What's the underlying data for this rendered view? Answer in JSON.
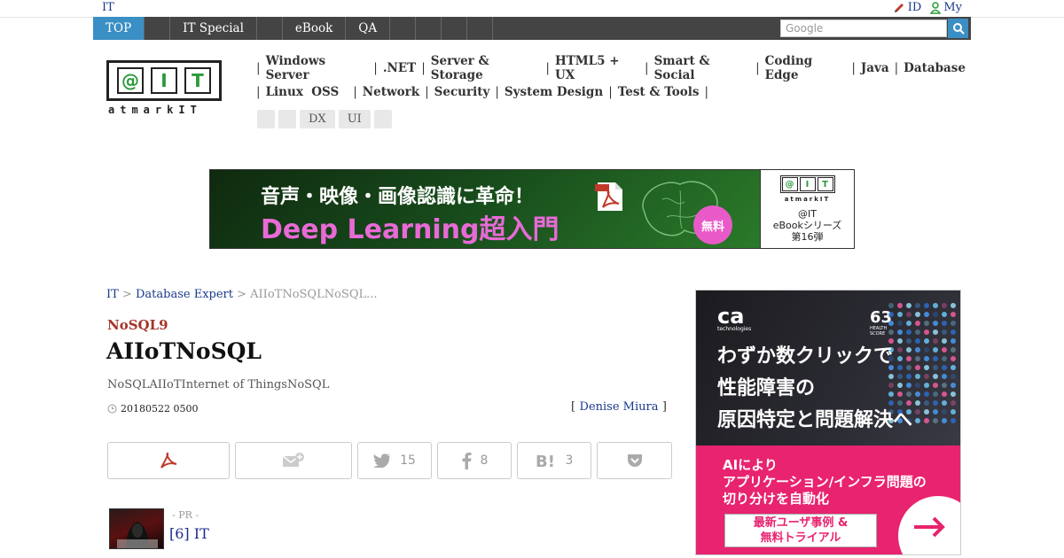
{
  "top_strip": {
    "site_label": "IT",
    "id_link": "ID",
    "my_link": "My"
  },
  "nav": {
    "items": [
      "TOP",
      "",
      "IT Special",
      "",
      "eBook",
      "QA",
      "",
      "",
      "",
      ""
    ],
    "search_placeholder": "Google"
  },
  "logo": {
    "cells": [
      "@",
      "I",
      "T"
    ],
    "subtitle": "atmarkIT"
  },
  "categories": {
    "row1": [
      "Windows Server",
      ".NET",
      "Server & Storage",
      "HTML5 + UX",
      "Smart & Social",
      "Coding Edge",
      "Java",
      "Database"
    ],
    "row2": [
      "Linux  OSS",
      "Network",
      "Security",
      "System Design",
      "Test & Tools"
    ],
    "tags": [
      "",
      "",
      "DX",
      "UI",
      ""
    ]
  },
  "banner": {
    "line1": "音声・映像・画像認識に革命！",
    "line2": "Deep Learning超入門",
    "free_badge": "無料",
    "side_logo": [
      "@",
      "I",
      "T"
    ],
    "side_logo_sub": "atmarkIT",
    "side_line1": "@IT",
    "side_line2": "eBookシリーズ",
    "side_line3": "第16弾"
  },
  "breadcrumb": {
    "home": "IT",
    "sep": " > ",
    "section": "Database Expert",
    "current": "AIIoTNoSQLNoSQL..."
  },
  "article": {
    "series": "NoSQL9",
    "title": "AIIoTNoSQL",
    "subtitle": "NoSQLAIIoTInternet of ThingsNoSQL",
    "date": "20180522 0500",
    "author_open": "[",
    "author": "Denise Miura",
    "author_close": "]"
  },
  "share": {
    "twitter_count": "15",
    "facebook_count": "8",
    "hatena_count": "3"
  },
  "pr": {
    "label": "- PR -",
    "link": "[6] IT"
  },
  "ad": {
    "brand": "ca",
    "brand_sub": "technologies",
    "score": "63",
    "score_sub": "HEALTH SCORE",
    "headline1": "わずか数クリックで",
    "headline2": "性能障害の",
    "headline3": "原因特定と問題解決へ",
    "sub1": "AIにより",
    "sub2": "アプリケーション/インフラ問題の",
    "sub3": "切り分けを自動化",
    "cta1": "最新ユーザ事例 &",
    "cta2": "無料トライアル"
  },
  "colors": {
    "nav_bg": "#444444",
    "nav_active": "#3a8fc4",
    "link": "#1a3a8c",
    "series": "#a6352a",
    "ad_pink": "#e8236f",
    "logo_green": "#2b9a3a"
  }
}
